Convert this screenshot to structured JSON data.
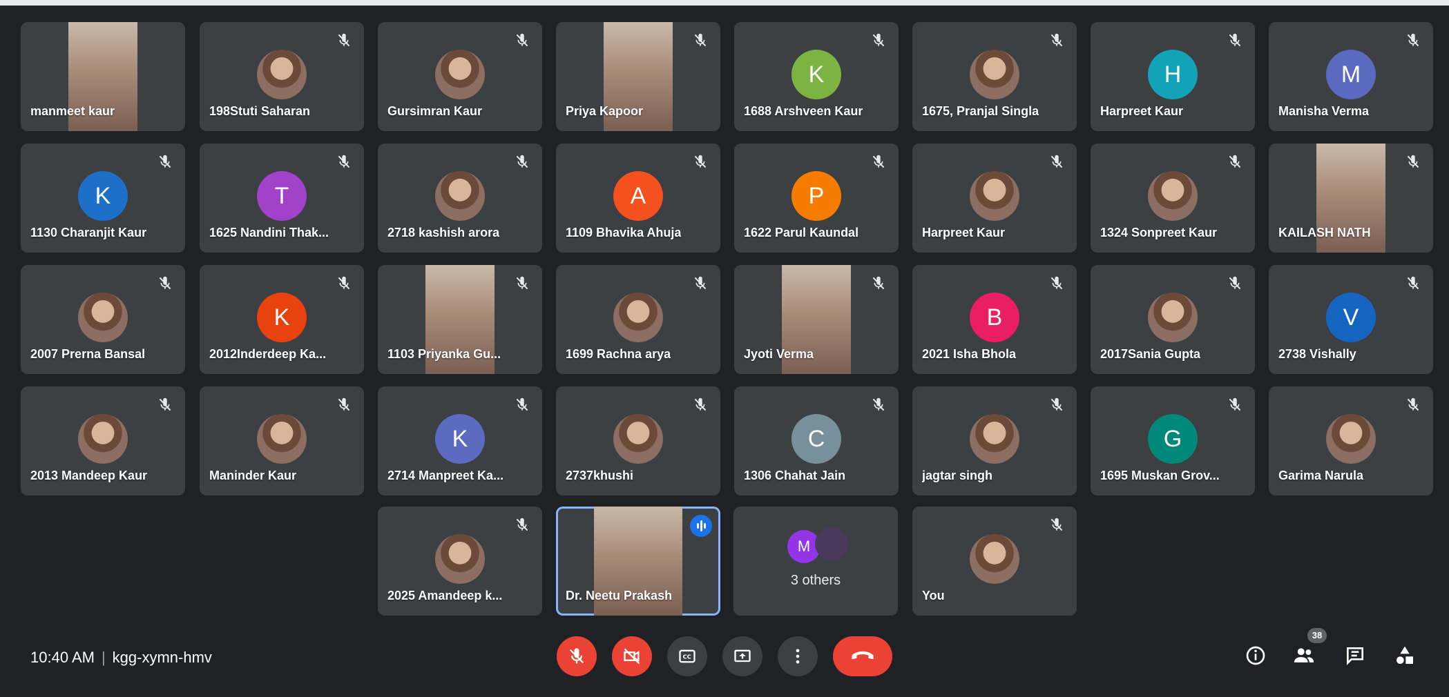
{
  "meeting": {
    "time": "10:40 AM",
    "code": "kgg-xymn-hmv",
    "participant_count": "38"
  },
  "colors": {
    "background": "#202124",
    "tile": "#3c4043",
    "danger": "#ea4335",
    "speaking_border": "#8ab4f8",
    "speaking_indicator": "#1a73e8"
  },
  "tiles": [
    {
      "name": "manmeet kaur",
      "media": "video",
      "muted": false
    },
    {
      "name": "198Stuti Saharan",
      "media": "photo",
      "muted": true
    },
    {
      "name": "Gursimran Kaur",
      "media": "photo",
      "muted": true
    },
    {
      "name": "Priya Kapoor",
      "media": "video",
      "muted": true
    },
    {
      "name": "1688 Arshveen Kaur",
      "media": "initial",
      "initial": "K",
      "color": "#7cb342",
      "muted": true
    },
    {
      "name": "1675, Pranjal Singla",
      "media": "photo",
      "muted": true
    },
    {
      "name": "Harpreet Kaur",
      "media": "initial",
      "initial": "H",
      "color": "#12a3b8",
      "muted": true
    },
    {
      "name": "Manisha Verma",
      "media": "initial",
      "initial": "M",
      "color": "#5c6bc0",
      "muted": true
    },
    {
      "name": "1130 Charanjit Kaur",
      "media": "initial",
      "initial": "K",
      "color": "#1e6fc8",
      "muted": true
    },
    {
      "name": "1625 Nandini Thak...",
      "media": "initial",
      "initial": "T",
      "color": "#a142c9",
      "muted": true
    },
    {
      "name": "2718 kashish arora",
      "media": "photo",
      "muted": true
    },
    {
      "name": "1109 Bhavika Ahuja",
      "media": "initial",
      "initial": "A",
      "color": "#f4511e",
      "muted": true
    },
    {
      "name": "1622 Parul Kaundal",
      "media": "initial",
      "initial": "P",
      "color": "#f57c00",
      "muted": true
    },
    {
      "name": "Harpreet Kaur",
      "media": "photo",
      "muted": true
    },
    {
      "name": "1324 Sonpreet Kaur",
      "media": "photo",
      "muted": true
    },
    {
      "name": "KAILASH NATH",
      "media": "video",
      "muted": true
    },
    {
      "name": "2007 Prerna Bansal",
      "media": "photo",
      "muted": true
    },
    {
      "name": "2012Inderdeep Ka...",
      "media": "initial",
      "initial": "K",
      "color": "#e8430e",
      "muted": true
    },
    {
      "name": "1103 Priyanka Gu...",
      "media": "video",
      "muted": true
    },
    {
      "name": "1699 Rachna arya",
      "media": "photo",
      "muted": true
    },
    {
      "name": "Jyoti Verma",
      "media": "video",
      "muted": true
    },
    {
      "name": "2021 Isha Bhola",
      "media": "initial",
      "initial": "B",
      "color": "#e91e63",
      "muted": true
    },
    {
      "name": "2017Sania Gupta",
      "media": "photo",
      "muted": true
    },
    {
      "name": "2738 Vishally",
      "media": "initial",
      "initial": "V",
      "color": "#1565c0",
      "muted": true
    },
    {
      "name": "2013 Mandeep Kaur",
      "media": "photo",
      "muted": true
    },
    {
      "name": "Maninder Kaur",
      "media": "photo",
      "muted": true
    },
    {
      "name": "2714 Manpreet Ka...",
      "media": "initial",
      "initial": "K",
      "color": "#5c6bc0",
      "muted": true
    },
    {
      "name": "2737khushi",
      "media": "photo",
      "muted": true
    },
    {
      "name": "1306 Chahat Jain",
      "media": "initial",
      "initial": "C",
      "color": "#78909c",
      "muted": true
    },
    {
      "name": "jagtar singh",
      "media": "photo",
      "muted": true
    },
    {
      "name": "1695 Muskan Grov...",
      "media": "initial",
      "initial": "G",
      "color": "#00897b",
      "muted": true
    },
    {
      "name": "Garima Narula",
      "media": "photo",
      "muted": true
    },
    {
      "name": "2025 Amandeep k...",
      "media": "photo",
      "muted": true
    },
    {
      "name": "Dr. Neetu Prakash",
      "media": "video",
      "muted": false,
      "speaking": true
    },
    {
      "name": "You",
      "media": "photo",
      "muted": true
    }
  ],
  "others": {
    "label": "3 others",
    "initial": "M"
  },
  "controls": {
    "center": [
      "microphone-off",
      "camera-off",
      "captions",
      "present-screen",
      "more-options",
      "leave-call"
    ],
    "right": [
      "meeting-details",
      "people",
      "chat",
      "activities"
    ]
  }
}
